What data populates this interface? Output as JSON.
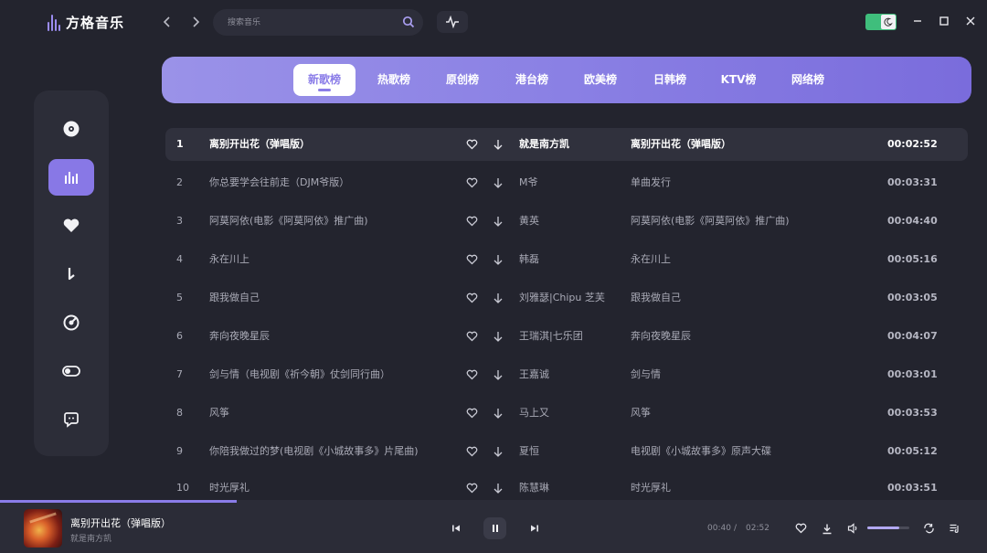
{
  "app": {
    "name": "方格音乐"
  },
  "search": {
    "placeholder": "搜索音乐"
  },
  "tabs": [
    {
      "label": "新歌榜",
      "active": true
    },
    {
      "label": "热歌榜",
      "active": false
    },
    {
      "label": "原创榜",
      "active": false
    },
    {
      "label": "港台榜",
      "active": false
    },
    {
      "label": "欧美榜",
      "active": false
    },
    {
      "label": "日韩榜",
      "active": false
    },
    {
      "label": "KTV榜",
      "active": false
    },
    {
      "label": "网络榜",
      "active": false
    }
  ],
  "sidebar": {
    "items": [
      {
        "icon": "disc-icon",
        "active": false
      },
      {
        "icon": "chart-bars-icon",
        "active": true
      },
      {
        "icon": "heart-icon",
        "active": false
      },
      {
        "icon": "music-note-icon",
        "active": false
      },
      {
        "icon": "radio-target-icon",
        "active": false
      },
      {
        "icon": "toggle-icon",
        "active": false
      },
      {
        "icon": "chat-bubble-icon",
        "active": false
      }
    ]
  },
  "songs": [
    {
      "rank": "1",
      "title": "离别开出花（弹唱版）",
      "artist": "就是南方凯",
      "album": "离别开出花（弹唱版）",
      "duration": "00:02:52",
      "playing": true
    },
    {
      "rank": "2",
      "title": "你总要学会往前走（DJM爷版）",
      "artist": "M爷",
      "album": "单曲发行",
      "duration": "00:03:31",
      "playing": false
    },
    {
      "rank": "3",
      "title": "阿莫阿依(电影《阿莫阿依》推广曲)",
      "artist": "黄英",
      "album": "阿莫阿依(电影《阿莫阿依》推广曲)",
      "duration": "00:04:40",
      "playing": false
    },
    {
      "rank": "4",
      "title": "永在川上",
      "artist": "韩磊",
      "album": "永在川上",
      "duration": "00:05:16",
      "playing": false
    },
    {
      "rank": "5",
      "title": "跟我做自己",
      "artist": "刘雅瑟|Chipu 芝芙",
      "album": "跟我做自己",
      "duration": "00:03:05",
      "playing": false
    },
    {
      "rank": "6",
      "title": "奔向夜晚星辰",
      "artist": "王瑞淇|七乐团",
      "album": "奔向夜晚星辰",
      "duration": "00:04:07",
      "playing": false
    },
    {
      "rank": "7",
      "title": "剑与情（电视剧《祈今朝》仗剑同行曲）",
      "artist": "王嘉诚",
      "album": "剑与情",
      "duration": "00:03:01",
      "playing": false
    },
    {
      "rank": "8",
      "title": "风筝",
      "artist": "马上又",
      "album": "风筝",
      "duration": "00:03:53",
      "playing": false
    },
    {
      "rank": "9",
      "title": "你陪我做过的梦(电视剧《小城故事多》片尾曲)",
      "artist": "夏恒",
      "album": "电视剧《小城故事多》原声大碟",
      "duration": "00:05:12",
      "playing": false
    },
    {
      "rank": "10",
      "title": "时光厚礼",
      "artist": "陈慧琳",
      "album": "时光厚礼",
      "duration": "00:03:51",
      "playing": false
    }
  ],
  "player": {
    "title": "离别开出花（弹唱版）",
    "artist": "就是南方凯",
    "current_time": "00:40",
    "separator": "/",
    "total_time": "02:52",
    "progress": 0.24,
    "volume": 0.75
  },
  "colors": {
    "accent": "#8a7ce8",
    "background": "#23242e",
    "panel": "#2c2d38",
    "toggle": "#3fbe7c"
  }
}
